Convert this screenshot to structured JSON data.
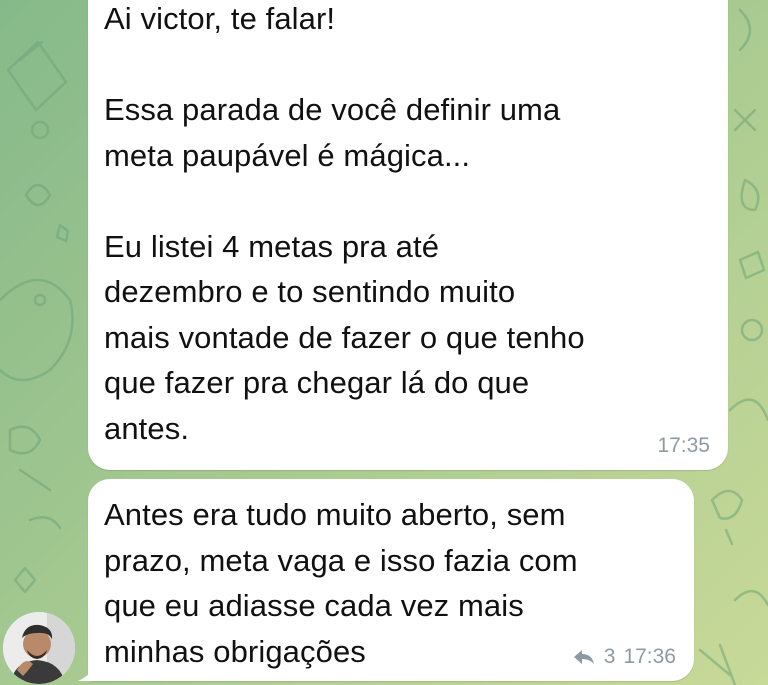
{
  "chat": {
    "messages": [
      {
        "text": "Ai victor, te falar!\n\nEssa parada de você definir uma\nmeta paupável é mágica...\n\nEu listei 4 metas pra até\ndezembro e to sentindo muito\nmais vontade de fazer o que tenho\nque fazer pra chegar lá do que\nantes.",
        "time": "17:35"
      },
      {
        "text": "Antes era tudo muito aberto, sem\nprazo, meta vaga e isso fazia com\nque eu adiasse cada vez mais\nminhas obrigações",
        "reply_count": "3",
        "time": "17:36",
        "reply_icon": "reply-arrow-icon"
      }
    ],
    "avatar_icon": "user-avatar",
    "colors": {
      "bubble": "#ffffff",
      "text": "#111111",
      "meta": "#8e9aa3",
      "background": "#9cc48e"
    }
  }
}
